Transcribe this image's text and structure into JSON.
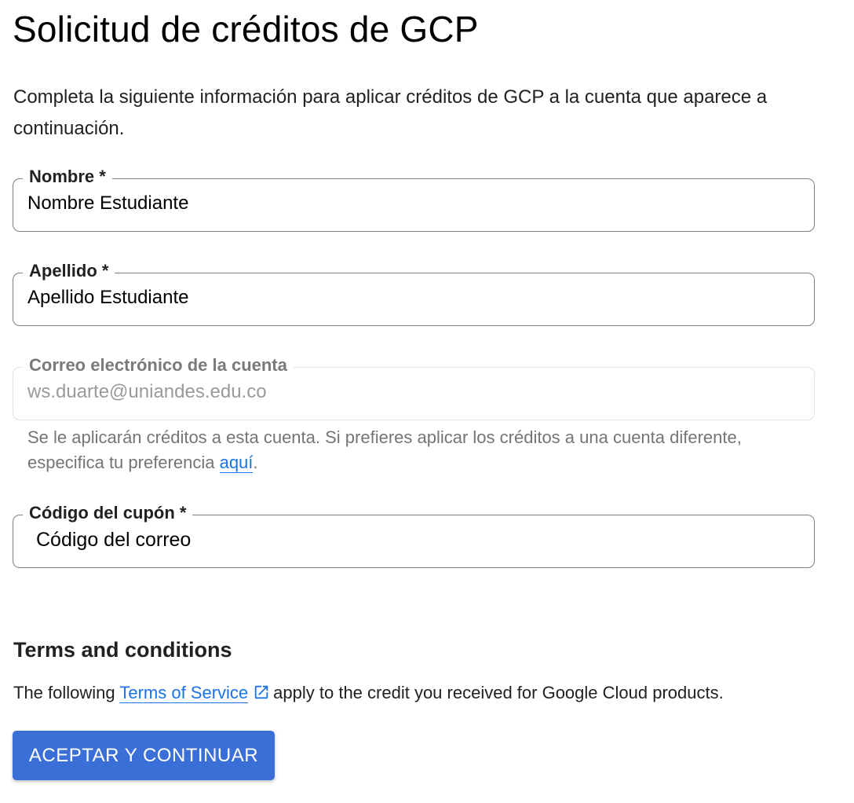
{
  "page": {
    "title": "Solicitud de créditos de GCP",
    "intro": "Completa la siguiente información para aplicar créditos de GCP a la cuenta que aparece a continuación."
  },
  "form": {
    "first_name": {
      "label": "Nombre *",
      "value": "Nombre Estudiante"
    },
    "last_name": {
      "label": "Apellido *",
      "value": "Apellido Estudiante"
    },
    "email": {
      "label": "Correo electrónico de la cuenta",
      "value": "ws.duarte@uniandes.edu.co",
      "disabled": true,
      "helper_text": "Se le aplicarán créditos a esta cuenta. Si prefieres aplicar los créditos a una cuenta diferente, especifica tu preferencia ",
      "helper_link": "aquí",
      "helper_end": "."
    },
    "coupon": {
      "label": "Código del cupón *",
      "value": "Código del correo"
    }
  },
  "terms": {
    "title": "Terms and conditions",
    "text_before": "The following ",
    "link": "Terms of Service",
    "link_icon": "open-in-new-icon",
    "text_after": "apply to the credit you received for Google Cloud products."
  },
  "actions": {
    "submit_label": "ACEPTAR Y CONTINUAR"
  },
  "colors": {
    "accent": "#1a73e8",
    "button": "#3b6fd8",
    "border": "#7f7f7f",
    "disabled_border": "#e0e0e0",
    "helper_text": "#757575"
  }
}
